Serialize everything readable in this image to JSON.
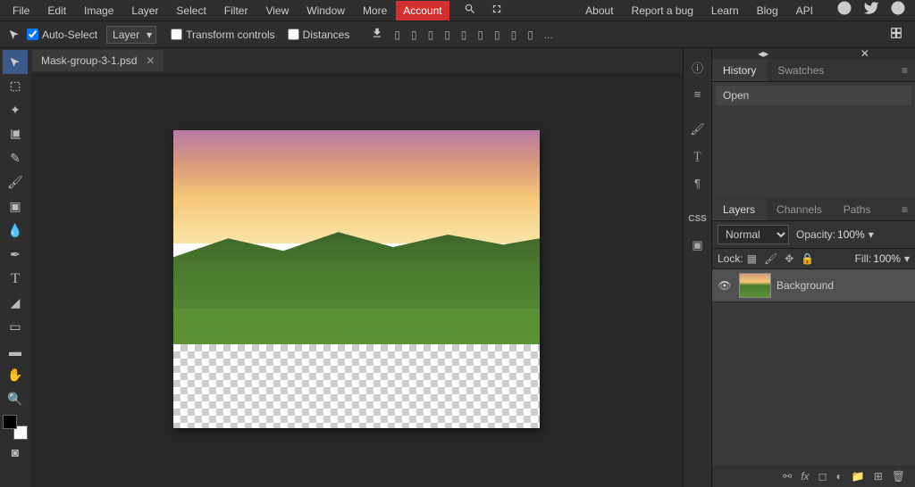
{
  "menu": {
    "file": "File",
    "edit": "Edit",
    "image": "Image",
    "layer": "Layer",
    "select": "Select",
    "filter": "Filter",
    "view": "View",
    "window": "Window",
    "more": "More",
    "account": "Account"
  },
  "nav": {
    "about": "About",
    "report": "Report a bug",
    "learn": "Learn",
    "blog": "Blog",
    "api": "API"
  },
  "options": {
    "autoselect": "Auto-Select",
    "layer_dropdown": "Layer",
    "transform": "Transform controls",
    "distances": "Distances",
    "more": "..."
  },
  "file_tab": {
    "name": "Mask-group-3-1.psd"
  },
  "panels": {
    "history_tab": "History",
    "swatches_tab": "Swatches",
    "history_items": [
      "Open"
    ],
    "layers_tab": "Layers",
    "channels_tab": "Channels",
    "paths_tab": "Paths",
    "blend_mode": "Normal",
    "opacity_label": "Opacity:",
    "opacity_value": "100%",
    "lock_label": "Lock:",
    "fill_label": "Fill:",
    "fill_value": "100%",
    "layers": [
      {
        "name": "Background"
      }
    ]
  },
  "right_icons": {
    "css": "CSS"
  }
}
